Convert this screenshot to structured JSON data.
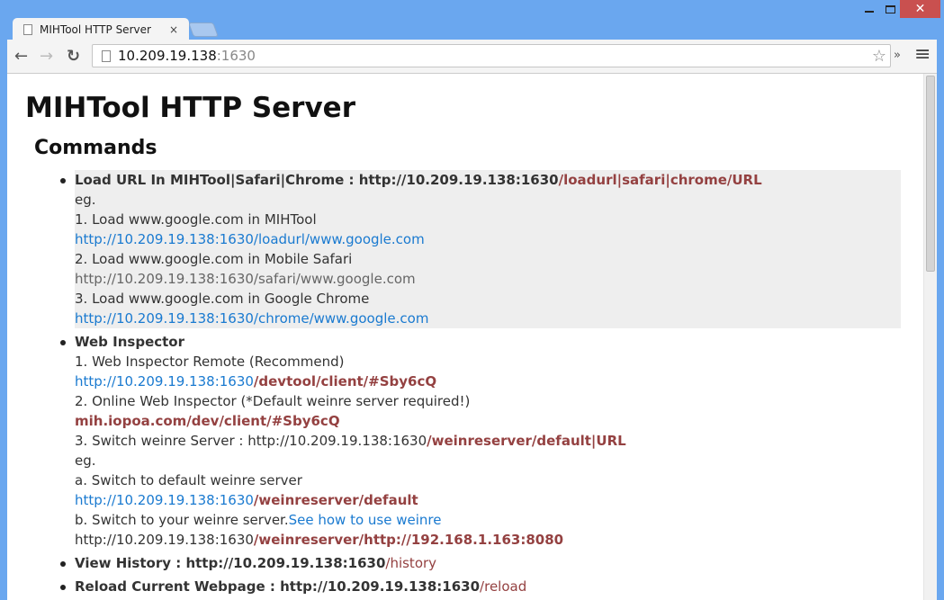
{
  "window": {
    "minimize": "",
    "maximize": "",
    "close": "✕"
  },
  "tab": {
    "title": "MIHTool HTTP Server",
    "close": "×"
  },
  "address": {
    "host": "10.209.19.138",
    "port": ":1630"
  },
  "toolbar": {
    "back": "←",
    "forward": "→",
    "reload": "↻",
    "star": "☆",
    "more": "»",
    "menu": "≡"
  },
  "page": {
    "title": "MIHTool HTTP Server",
    "section": "Commands"
  },
  "items": [
    {
      "lines": [
        [
          "Load URL In MIHTool|Safari|Chrome : http://10.209.19.138:1630",
          "/loadurl|safari|chrome/URL"
        ],
        [
          "eg."
        ],
        [
          "1. Load www.google.com in MIHTool"
        ],
        [
          "http://10.209.19.138:1630/loadurl/www.google.com"
        ],
        [
          "2. Load www.google.com in Mobile Safari"
        ],
        [
          "http://10.209.19.138:1630/safari/www.google.com"
        ],
        [
          "3. Load www.google.com in Google Chrome"
        ],
        [
          "http://10.209.19.138:1630/chrome/www.google.com"
        ]
      ]
    },
    {
      "lines": [
        [
          "Web Inspector"
        ],
        [
          "1. Web Inspector Remote (Recommend)"
        ],
        [
          "http://10.209.19.138:1630",
          "/devtool/client/#Sby6cQ"
        ],
        [
          "2. Online Web Inspector (*Default weinre server required!)"
        ],
        [
          "mih.iopoa.com/dev/client/#Sby6cQ"
        ],
        [
          "3. Switch weinre Server : http://10.209.19.138:1630",
          "/weinreserver/default|URL"
        ],
        [
          "eg."
        ],
        [
          "a. Switch to default weinre server"
        ],
        [
          "http://10.209.19.138:1630",
          "/weinreserver/default"
        ],
        [
          "b. Switch to your weinre server.",
          "See how to use weinre"
        ],
        [
          "http://10.209.19.138:1630",
          "/weinreserver/http://192.168.1.163:8080"
        ]
      ]
    },
    {
      "lines": [
        [
          "View History : http://10.209.19.138:1630",
          "/history"
        ]
      ]
    },
    {
      "lines": [
        [
          "Reload Current Webpage : http://10.209.19.138:1630",
          "/reload"
        ]
      ]
    }
  ]
}
